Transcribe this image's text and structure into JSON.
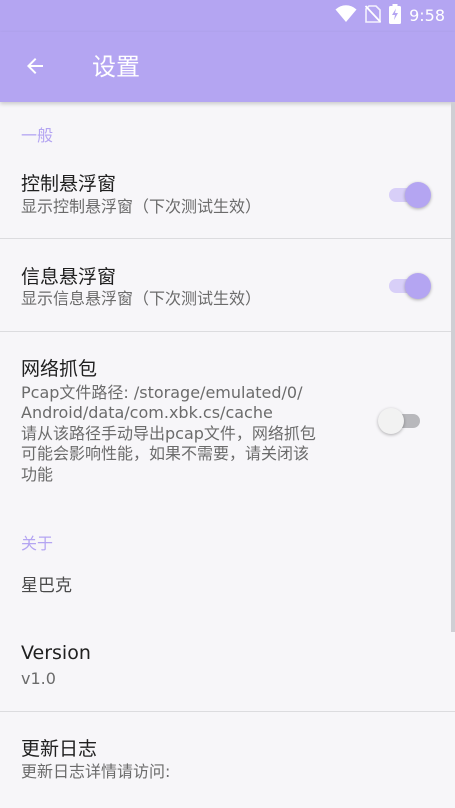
{
  "status_bar": {
    "time": "9:58",
    "icons": [
      "wifi-icon",
      "no-sim-icon",
      "battery-charging-icon"
    ]
  },
  "app_bar": {
    "back_icon": "arrow-left-icon",
    "title": "设置"
  },
  "sections": {
    "general": {
      "header": "一般",
      "items": [
        {
          "title": "控制悬浮窗",
          "summary": "显示控制悬浮窗（下次测试生效）",
          "switch_on": true
        },
        {
          "title": "信息悬浮窗",
          "summary": "显示信息悬浮窗（下次测试生效）",
          "switch_on": true
        },
        {
          "title": "网络抓包",
          "summary_lines": [
            "Pcap文件路径: /storage/emulated/0/",
            "Android/data/com.xbk.cs/cache",
            "请从该路径手动导出pcap文件，网络抓包",
            "可能会影响性能，如果不需要，请关闭该",
            "功能"
          ],
          "switch_on": false
        }
      ]
    },
    "about": {
      "header": "关于",
      "items": [
        {
          "title": "星巴克"
        },
        {
          "title": "Version",
          "summary": "v1.0"
        },
        {
          "title": "更新日志",
          "summary": "更新日志详情请访问:"
        }
      ]
    }
  },
  "colors": {
    "accent": "#b4a5f2",
    "switch_track_on": "#d8cff8",
    "switch_track_off": "#b8b8bc",
    "background": "#f7f6f9"
  }
}
